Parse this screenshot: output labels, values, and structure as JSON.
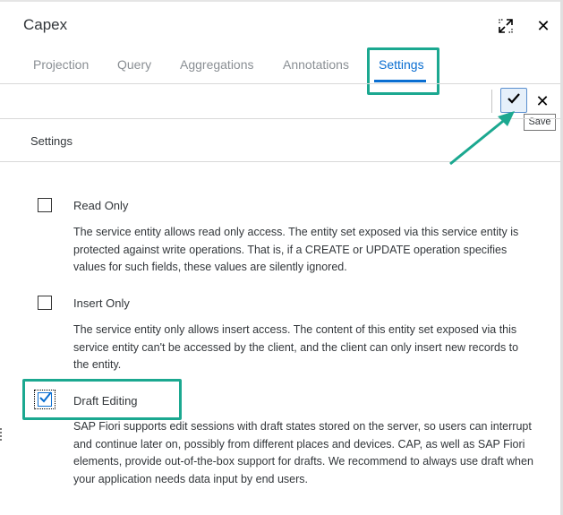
{
  "dialog": {
    "title": "Capex"
  },
  "tabs": [
    {
      "label": "Projection",
      "active": false
    },
    {
      "label": "Query",
      "active": false
    },
    {
      "label": "Aggregations",
      "active": false
    },
    {
      "label": "Annotations",
      "active": false
    },
    {
      "label": "Settings",
      "active": true
    }
  ],
  "toolbar": {
    "save_tooltip": "Save"
  },
  "section": {
    "title": "Settings"
  },
  "options": [
    {
      "label": "Read Only",
      "checked": false,
      "description": "The service entity allows read only access. The entity set exposed via this service entity is protected against write operations. That is, if a CREATE or UPDATE operation specifies values for such fields, these values are silently ignored."
    },
    {
      "label": "Insert Only",
      "checked": false,
      "description": "The service entity only allows insert access. The content of this entity set exposed via this service entity can't be accessed by the client, and the client can only insert new records to the entity."
    },
    {
      "label": "Draft Editing",
      "checked": true,
      "description": "SAP Fiori supports edit sessions with draft states stored on the server, so users can interrupt and continue later on, possibly from different places and devices. CAP, as well as SAP Fiori elements, provide out-of-the-box support for drafts. We recommend to always use draft when your application needs data input by end users."
    }
  ],
  "colors": {
    "accent": "#0a6ed1",
    "highlight": "#1ba890",
    "text": "#32363a",
    "inactive_tab": "#8a8f94"
  },
  "icons": {
    "expand": "expand-icon",
    "close": "close-icon",
    "save": "checkmark-icon",
    "cancel": "close-icon",
    "checkbox_mark": "checkmark-icon"
  }
}
